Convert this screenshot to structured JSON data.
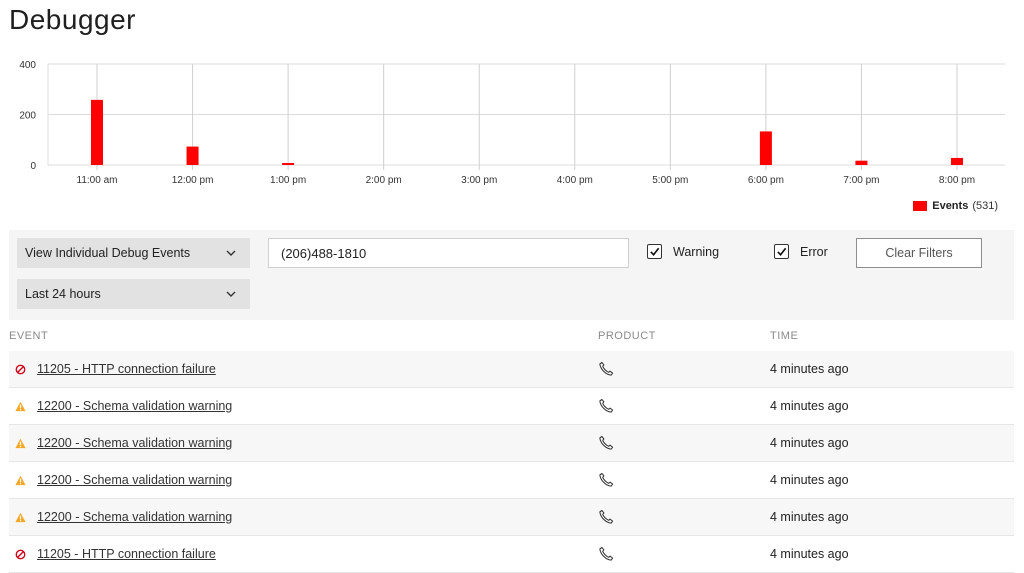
{
  "page": {
    "title": "Debugger"
  },
  "chart_data": {
    "type": "bar",
    "categories": [
      "11:00 am",
      "12:00 pm",
      "1:00 pm",
      "2:00 pm",
      "3:00 pm",
      "4:00 pm",
      "5:00 pm",
      "6:00 pm",
      "7:00 pm",
      "8:00 pm"
    ],
    "values": [
      258,
      73,
      7,
      0,
      0,
      0,
      0,
      133,
      17,
      28
    ],
    "ylim": [
      0,
      400
    ],
    "yticks": [
      0,
      200,
      400
    ],
    "grid": true,
    "series": [
      {
        "name": "Events",
        "color": "#ff0000"
      }
    ],
    "legend": {
      "label": "Events",
      "count": "(531)",
      "position": "bottom-right"
    }
  },
  "filters": {
    "view_select": "View Individual Debug Events",
    "time_select": "Last 24 hours",
    "search_value": "(206)488-1810",
    "warning_label": "Warning",
    "warning_checked": true,
    "error_label": "Error",
    "error_checked": true,
    "clear_label": "Clear Filters"
  },
  "table": {
    "headers": {
      "event": "EVENT",
      "product": "PRODUCT",
      "time": "TIME"
    },
    "rows": [
      {
        "type": "error",
        "event": "11205 - HTTP connection failure",
        "product_icon": "phone-icon",
        "time": "4 minutes ago"
      },
      {
        "type": "warning",
        "event": "12200 - Schema validation warning",
        "product_icon": "phone-icon",
        "time": "4 minutes ago"
      },
      {
        "type": "warning",
        "event": "12200 - Schema validation warning",
        "product_icon": "phone-icon",
        "time": "4 minutes ago"
      },
      {
        "type": "warning",
        "event": "12200 - Schema validation warning",
        "product_icon": "phone-icon",
        "time": "4 minutes ago"
      },
      {
        "type": "warning",
        "event": "12200 - Schema validation warning",
        "product_icon": "phone-icon",
        "time": "4 minutes ago"
      },
      {
        "type": "error",
        "event": "11205 - HTTP connection failure",
        "product_icon": "phone-icon",
        "time": "4 minutes ago"
      }
    ]
  },
  "colors": {
    "error": "#d0021b",
    "warning": "#f5a623",
    "bar": "#ff0000"
  }
}
